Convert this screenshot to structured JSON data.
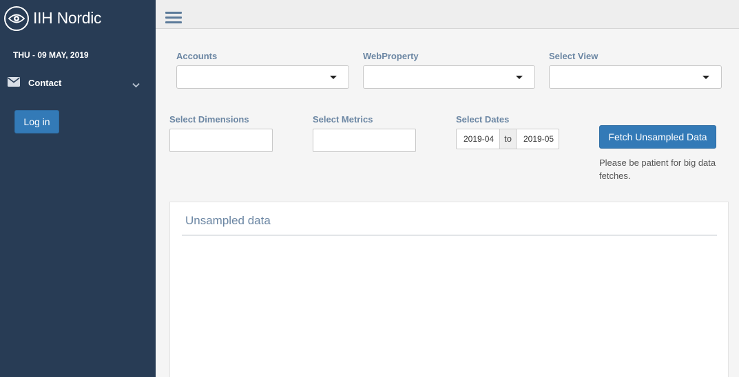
{
  "sidebar": {
    "brand": "IIH Nordic",
    "date": "THU - 09 MAY, 2019",
    "nav": [
      {
        "label": "Contact",
        "icon": "envelope-icon"
      }
    ],
    "login_label": "Log in"
  },
  "header": {
    "menu_icon": "hamburger-icon"
  },
  "form": {
    "accounts_label": "Accounts",
    "webproperty_label": "WebProperty",
    "view_label": "Select View",
    "dimensions_label": "Select Dimensions",
    "metrics_label": "Select Metrics",
    "dates_label": "Select Dates",
    "date_from": "2019-04",
    "date_sep": "to",
    "date_to": "2019-05",
    "fetch_label": "Fetch Unsampled Data",
    "hint": "Please be patient for big data fetches."
  },
  "panel": {
    "title": "Unsampled data"
  },
  "colors": {
    "sidebar_bg": "#283c55",
    "accent": "#337ab7",
    "label": "#6b86a3"
  }
}
